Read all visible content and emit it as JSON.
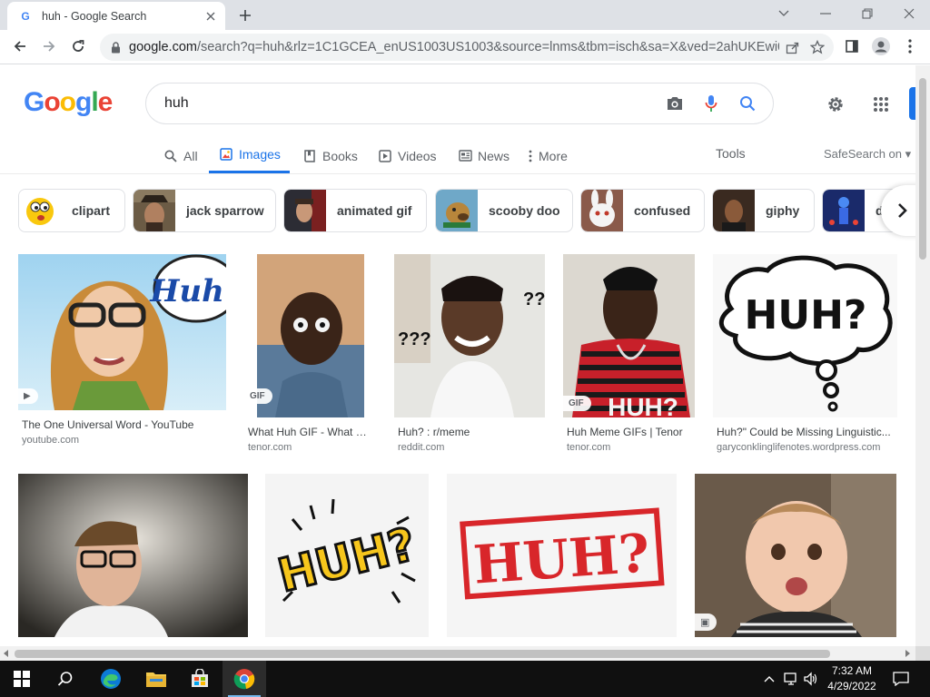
{
  "browser": {
    "tab_title": "huh - Google Search",
    "url_host": "google.com",
    "url_rest": "/search?q=huh&rlz=1C1GCEA_enUS1003US1003&source=lnms&tbm=isch&sa=X&ved=2ahUKEwi0..."
  },
  "google": {
    "logo_letters": [
      "G",
      "o",
      "o",
      "g",
      "l",
      "e"
    ],
    "logo_colors": [
      "#4285f4",
      "#ea4335",
      "#fbbc05",
      "#4285f4",
      "#34a853",
      "#ea4335"
    ],
    "query": "huh",
    "tabs": [
      {
        "label": "All",
        "icon": "search-icon"
      },
      {
        "label": "Images",
        "icon": "image-icon",
        "active": true
      },
      {
        "label": "Books",
        "icon": "book-icon"
      },
      {
        "label": "Videos",
        "icon": "play-icon"
      },
      {
        "label": "News",
        "icon": "news-icon"
      },
      {
        "label": "More",
        "icon": "dots-icon"
      }
    ],
    "tools_label": "Tools",
    "safesearch_label": "SafeSearch on",
    "chips": [
      {
        "label": "clipart"
      },
      {
        "label": "jack sparrow"
      },
      {
        "label": "animated gif"
      },
      {
        "label": "scooby doo"
      },
      {
        "label": "confused"
      },
      {
        "label": "giphy"
      },
      {
        "label": "d"
      }
    ],
    "results_row1": [
      {
        "title": "The One Universal Word - YouTube",
        "source": "youtube.com",
        "badge": "▶",
        "image_text": "Huh?"
      },
      {
        "title": "What Huh GIF - What Huh Huh Meme...",
        "source": "tenor.com",
        "badge": "GIF"
      },
      {
        "title": "Huh? : r/meme",
        "source": "reddit.com",
        "image_text_left": "???",
        "image_text_right": "???"
      },
      {
        "title": "Huh Meme GIFs | Tenor",
        "source": "tenor.com",
        "badge": "GIF",
        "image_text": "HUH?"
      },
      {
        "title": "Huh?\" Could be Missing Linguistic...",
        "source": "garyconklinglifenotes.wordpress.com",
        "image_text": "HUH?"
      }
    ],
    "results_row2": [
      {
        "title": "",
        "source": ""
      },
      {
        "image_text": "HUH?"
      },
      {
        "image_text": "HUH?"
      },
      {
        "badge": "▣"
      }
    ]
  },
  "taskbar": {
    "time": "7:32 AM",
    "date": "4/29/2022"
  }
}
